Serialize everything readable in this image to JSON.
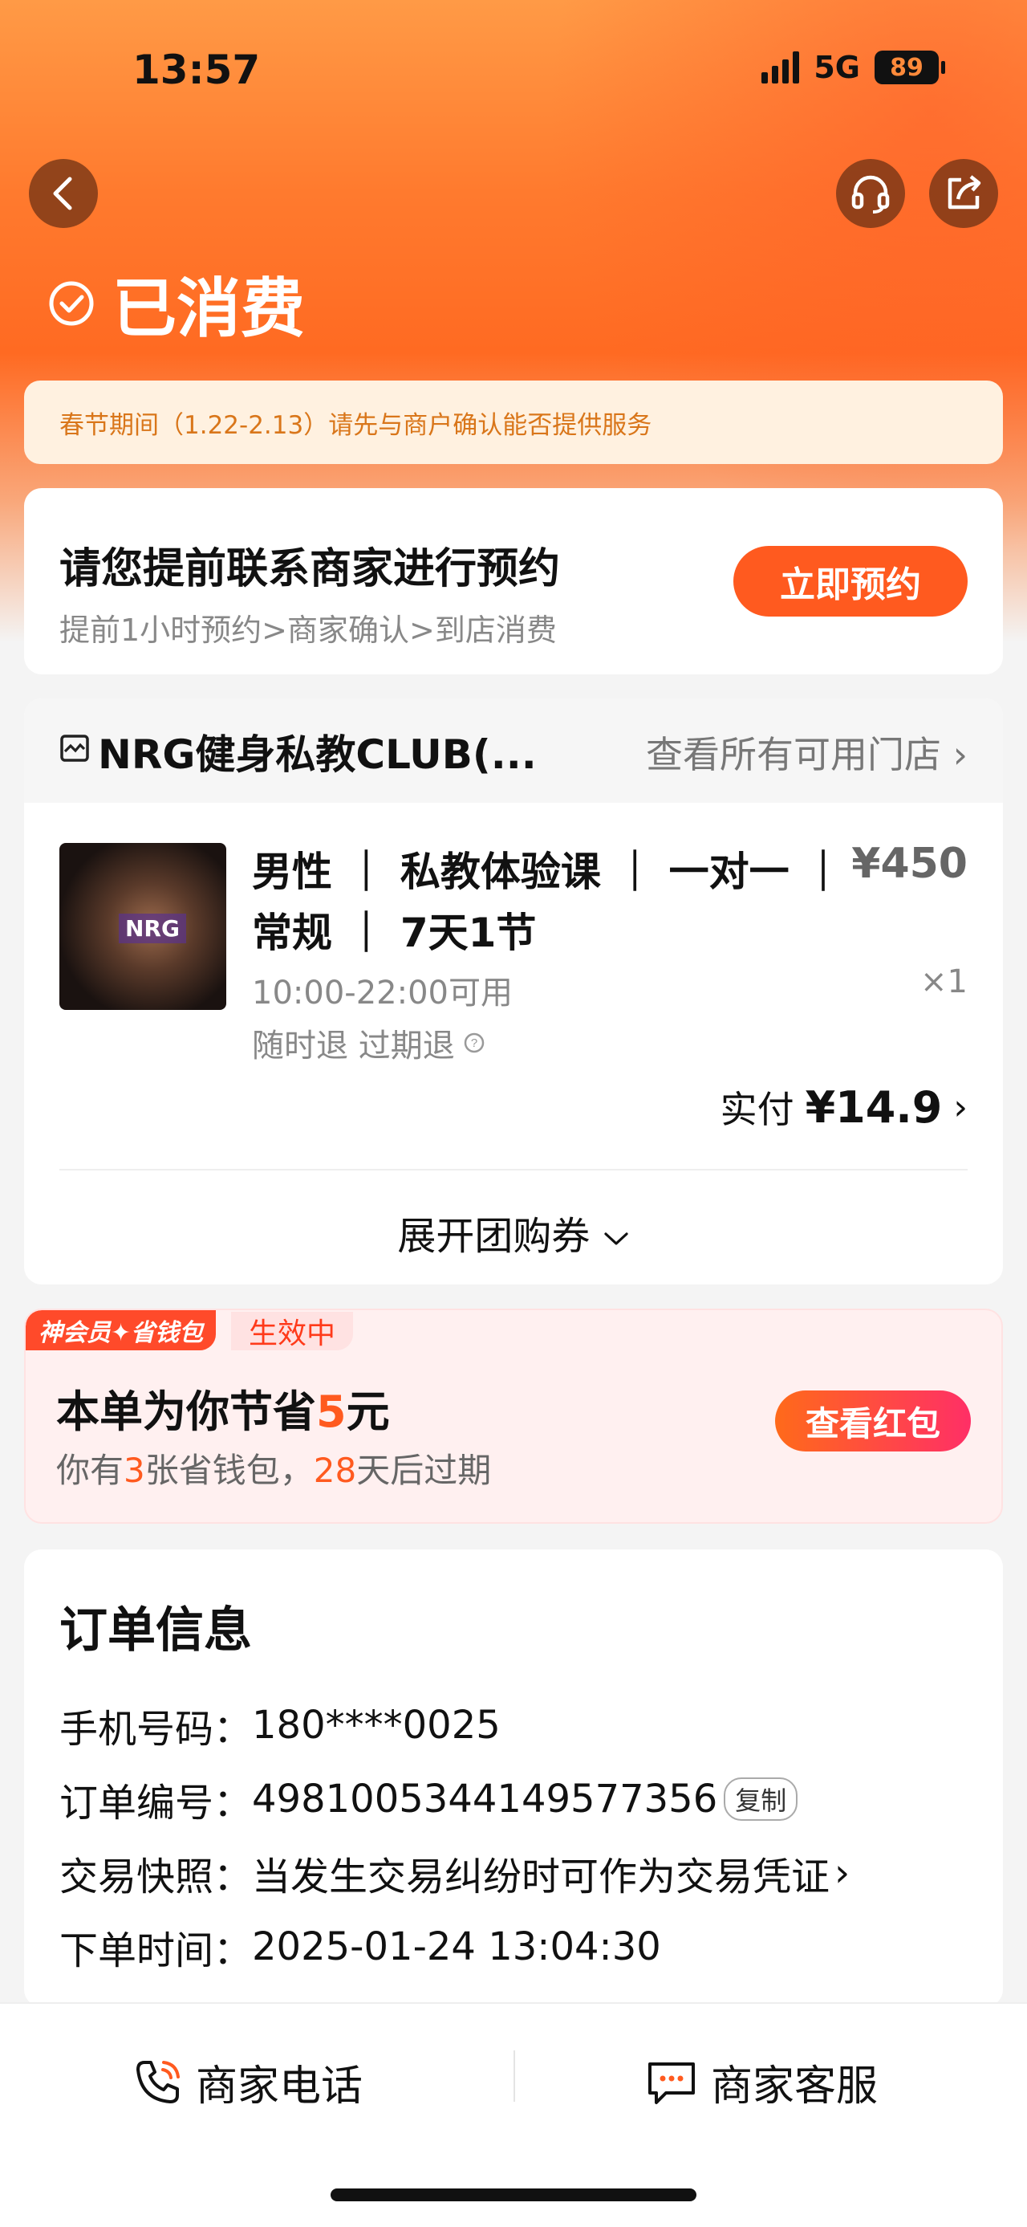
{
  "status_bar": {
    "time": "13:57",
    "network": "5G",
    "battery": "89"
  },
  "header": {
    "status_title": "已消费"
  },
  "notice": {
    "text": "春节期间（1.22-2.13）请先与商户确认能否提供服务"
  },
  "reservation": {
    "title": "请您提前联系商家进行预约",
    "subtitle": "提前1小时预约>商家确认>到店消费",
    "button": "立即预约"
  },
  "store": {
    "name": "NRG健身私教CLUB(...",
    "all_stores_link": "查看所有可用门店"
  },
  "product": {
    "thumb_label": "NRG",
    "name_line1": "男性 ｜ 私教体验课 ｜ 一对一 ｜",
    "name_line2": "常规 ｜ 7天1节",
    "hours": "10:00-22:00可用",
    "refund": "随时退 过期退",
    "price": "¥450",
    "qty": "×1",
    "paid_label": "实付",
    "paid_value": "¥14.9",
    "expand_label": "展开团购券"
  },
  "promo": {
    "tag": "神会员✦省钱包",
    "status": "生效中",
    "title_prefix": "本单为你节省",
    "title_amount": "5",
    "title_suffix": "元",
    "sub_p1": "你有",
    "sub_count": "3",
    "sub_p2": "张省钱包，",
    "sub_days": "28",
    "sub_p3": "天后过期",
    "button": "查看红包"
  },
  "order": {
    "title": "订单信息",
    "phone_label": "手机号码：",
    "phone_value": "180****0025",
    "number_label": "订单编号：",
    "number_value": "4981005344149577356",
    "copy_label": "复制",
    "snapshot_label": "交易快照：",
    "snapshot_value": "当发生交易纠纷时可作为交易凭证",
    "time_label": "下单时间：",
    "time_value": "2025-01-24 13:04:30"
  },
  "bottom": {
    "phone_button": "商家电话",
    "service_button": "商家客服"
  },
  "colors": {
    "accent": "#ff5a1f",
    "hero": "#ff7a2e",
    "notice_text": "#d9761a"
  }
}
